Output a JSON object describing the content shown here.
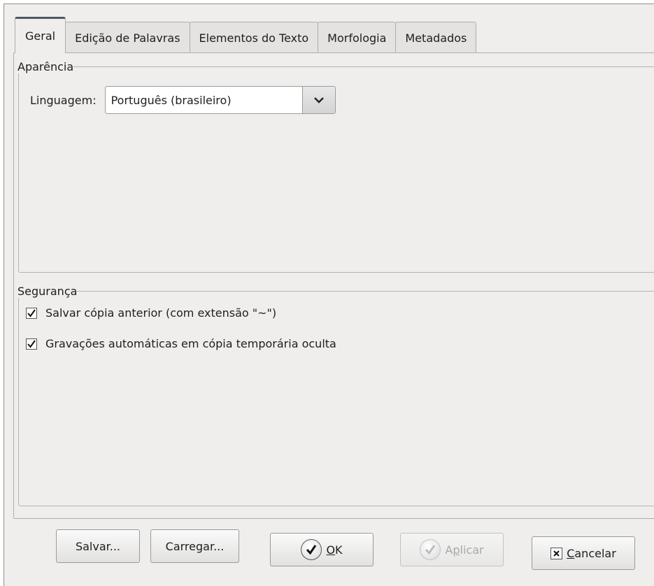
{
  "tabs": [
    {
      "label": "Geral",
      "active": true
    },
    {
      "label": "Edição de Palavras",
      "active": false
    },
    {
      "label": "Elementos do Texto",
      "active": false
    },
    {
      "label": "Morfologia",
      "active": false
    },
    {
      "label": "Metadados",
      "active": false
    }
  ],
  "aparencia": {
    "legend": "Aparência",
    "language_label": "Linguagem:",
    "language_value": "Português (brasileiro)"
  },
  "seguranca": {
    "legend": "Segurança",
    "options": [
      {
        "label": "Salvar cópia anterior (com extensão \"~\")",
        "checked": true
      },
      {
        "label": "Gravações automáticas em cópia temporária oculta",
        "checked": true
      }
    ]
  },
  "buttons": {
    "salvar": "Salvar...",
    "carregar": "Carregar...",
    "ok_mnemonic": "O",
    "ok_rest": "K",
    "aplicar_pre": "A",
    "aplicar_mnemonic": "p",
    "aplicar_rest": "licar",
    "cancelar_mnemonic": "C",
    "cancelar_rest": "ancelar"
  },
  "icons": {
    "ok": "checkmark-circle-icon",
    "aplicar": "checkmark-circle-icon",
    "cancelar": "close-box-icon",
    "combo": "chevron-down-icon",
    "checkbox": "checkmark-icon"
  }
}
